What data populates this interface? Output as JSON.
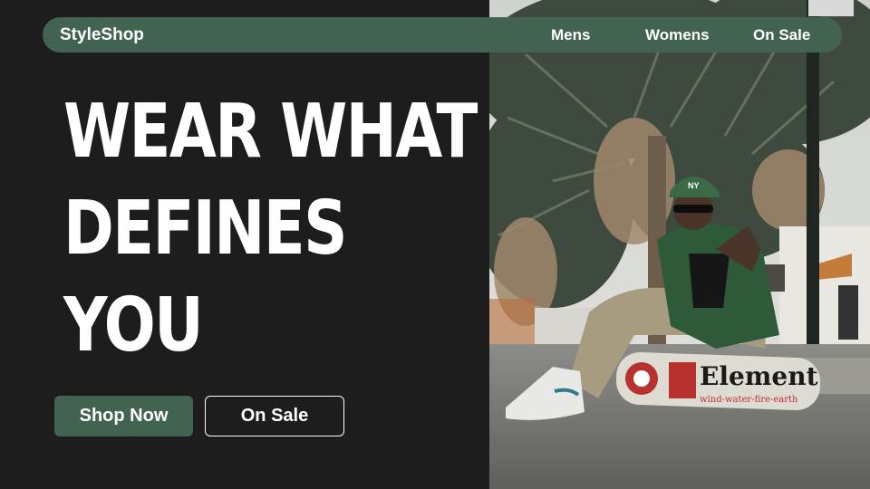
{
  "nav": {
    "brand": "StyleShop",
    "links": [
      "Mens",
      "Womens",
      "On Sale"
    ]
  },
  "hero": {
    "headline_lines": [
      "WEAR WHAT",
      "DEFINES",
      "YOU"
    ],
    "primary_cta": "Shop Now",
    "secondary_cta": "On Sale",
    "image_text": {
      "skateboard_brand": "Element",
      "skateboard_tagline": "wind-water-fire-earth",
      "cap_logo": "NY"
    }
  },
  "colors": {
    "background": "#1e1d1d",
    "accent": "#426352",
    "text": "#ffffff"
  }
}
